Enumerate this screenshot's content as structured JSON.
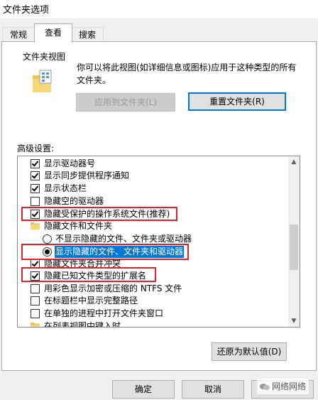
{
  "window": {
    "title": "文件夹选项"
  },
  "tabs": [
    {
      "label": "常规"
    },
    {
      "label": "查看"
    },
    {
      "label": "搜索"
    }
  ],
  "folder_views": {
    "group_label": "文件夹视图",
    "description": "你可以将此视图(如详细信息或图标)应用于这种类型的所有文件夹。",
    "apply_button": "应用到文件夹(L)",
    "reset_button": "重置文件夹(R)"
  },
  "advanced": {
    "label": "高级设置:",
    "items": [
      {
        "label": "显示驱动器号",
        "type": "checkbox",
        "checked": true
      },
      {
        "label": "显示同步提供程序通知",
        "type": "checkbox",
        "checked": true
      },
      {
        "label": "显示状态栏",
        "type": "checkbox",
        "checked": true
      },
      {
        "label": "隐藏空的驱动器",
        "type": "checkbox",
        "checked": false
      },
      {
        "label": "隐藏受保护的操作系统文件(推荐)",
        "type": "checkbox",
        "checked": true
      },
      {
        "label": "隐藏文件和文件夹",
        "type": "folder"
      },
      {
        "label": "不显示隐藏的文件、文件夹或驱动器",
        "type": "radio",
        "checked": false
      },
      {
        "label": "显示隐藏的文件、文件夹和驱动器",
        "type": "radio",
        "checked": true,
        "selected": true
      },
      {
        "label": "隐藏文件夹合并冲突",
        "type": "checkbox",
        "checked": true
      },
      {
        "label": "隐藏已知文件类型的扩展名",
        "type": "checkbox",
        "checked": true
      },
      {
        "label": "用彩色显示加密或压缩的 NTFS 文件",
        "type": "checkbox",
        "checked": false
      },
      {
        "label": "在标题栏中显示完整路径",
        "type": "checkbox",
        "checked": false
      },
      {
        "label": "在单独的进程中打开文件夹窗口",
        "type": "checkbox",
        "checked": false
      },
      {
        "label": "在列表视图中键入时",
        "type": "folder"
      }
    ]
  },
  "restore_defaults_button": "还原为默认值(D)",
  "footer": {
    "ok": "确定",
    "cancel": "取消"
  },
  "watermark": "网络网络",
  "colors": {
    "accent": "#0078d7",
    "highlight": "#e0202a"
  }
}
